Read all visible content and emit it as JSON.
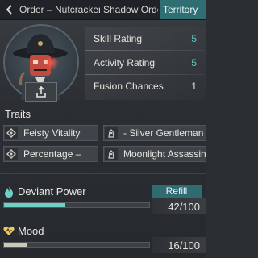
{
  "tabs": [
    {
      "label": "Order – Nutcracker"
    },
    {
      "label": "Shadow Order"
    },
    {
      "label": "Territory"
    }
  ],
  "ratings": [
    {
      "label": "Skill Rating",
      "value": "5"
    },
    {
      "label": "Activity Rating",
      "value": "5"
    },
    {
      "label": "Fusion Chances",
      "value": "1"
    }
  ],
  "traits": {
    "title": "Traits",
    "items": [
      {
        "label": "Feisty Vitality",
        "icon": "diamond-rune-icon"
      },
      {
        "label": "- Silver Gentleman",
        "icon": "figure-rune-icon"
      },
      {
        "label": "Percentage –",
        "icon": "diamond-rune-icon"
      },
      {
        "label": "Moonlight Assassin",
        "icon": "figure-rune-icon"
      }
    ]
  },
  "deviant_power": {
    "label": "Deviant Power",
    "value": "42/100",
    "fraction": 0.42,
    "button": "Refill",
    "icon": "flame-icon",
    "color": "#6fd1c6"
  },
  "mood": {
    "label": "Mood",
    "value": "16/100",
    "fraction": 0.16,
    "icon": "heart-icon",
    "color": "#c9c8bd"
  },
  "colors": {
    "accent": "#2f6f73",
    "teal_text": "#5ec9c2"
  }
}
